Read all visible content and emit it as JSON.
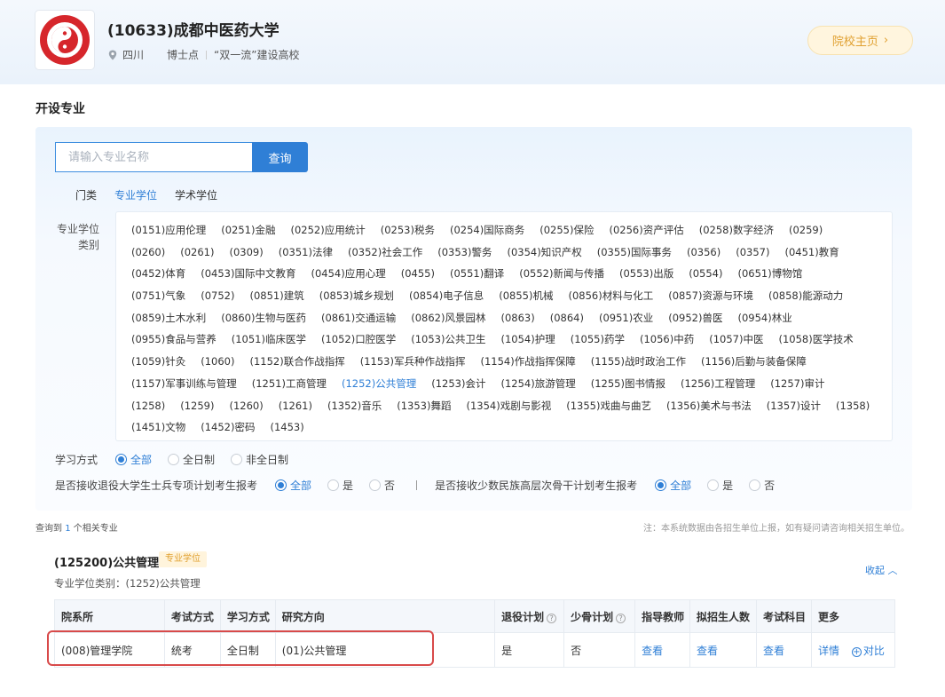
{
  "university": {
    "name": "(10633)成都中医药大学",
    "province": "四川",
    "tag_doctoral": "博士点",
    "tag_double_first": "“双一流”建设高校",
    "home_button": "院校主页",
    "colors": {
      "logo_red": "#d6262b",
      "accent": "#e0a030"
    }
  },
  "section_title": "开设专业",
  "search": {
    "placeholder": "请输入专业名称",
    "button": "查询"
  },
  "tabs": [
    {
      "label": "门类",
      "active": false
    },
    {
      "label": "专业学位",
      "active": true
    },
    {
      "label": "学术学位",
      "active": false
    }
  ],
  "category_label": "专业学位类别",
  "categories": [
    "(0151)应用伦理",
    "(0251)金融",
    "(0252)应用统计",
    "(0253)税务",
    "(0254)国际商务",
    "(0255)保险",
    "(0256)资产评估",
    "(0258)数字经济",
    "(0259)",
    "(0260)",
    "(0261)",
    "(0309)",
    "(0351)法律",
    "(0352)社会工作",
    "(0353)警务",
    "(0354)知识产权",
    "(0355)国际事务",
    "(0356)",
    "(0357)",
    "(0451)教育",
    "(0452)体育",
    "(0453)国际中文教育",
    "(0454)应用心理",
    "(0455)",
    "(0551)翻译",
    "(0552)新闻与传播",
    "(0553)出版",
    "(0554)",
    "(0651)博物馆",
    "(0751)气象",
    "(0752)",
    "(0851)建筑",
    "(0853)城乡规划",
    "(0854)电子信息",
    "(0855)机械",
    "(0856)材料与化工",
    "(0857)资源与环境",
    "(0858)能源动力",
    "(0859)土木水利",
    "(0860)生物与医药",
    "(0861)交通运输",
    "(0862)风景园林",
    "(0863)",
    "(0864)",
    "(0951)农业",
    "(0952)兽医",
    "(0954)林业",
    "(0955)食品与营养",
    "(1051)临床医学",
    "(1052)口腔医学",
    "(1053)公共卫生",
    "(1054)护理",
    "(1055)药学",
    "(1056)中药",
    "(1057)中医",
    "(1058)医学技术",
    "(1059)针灸",
    "(1060)",
    "(1152)联合作战指挥",
    "(1153)军兵种作战指挥",
    "(1154)作战指挥保障",
    "(1155)战时政治工作",
    "(1156)后勤与装备保障",
    "(1157)军事训练与管理",
    "(1251)工商管理",
    "(1252)公共管理",
    "(1253)会计",
    "(1254)旅游管理",
    "(1255)图书情报",
    "(1256)工程管理",
    "(1257)审计",
    "(1258)",
    "(1259)",
    "(1260)",
    "(1261)",
    "(1352)音乐",
    "(1353)舞蹈",
    "(1354)戏剧与影视",
    "(1355)戏曲与曲艺",
    "(1356)美术与书法",
    "(1357)设计",
    "(1358)",
    "(1451)文物",
    "(1452)密码",
    "(1453)"
  ],
  "selected_category": "(1252)公共管理",
  "filters": {
    "study_mode_label": "学习方式",
    "study_mode_options": [
      "全部",
      "全日制",
      "非全日制"
    ],
    "veteran_label": "是否接收退役大学生士兵专项计划考生报考",
    "veteran_options": [
      "全部",
      "是",
      "否"
    ],
    "minority_label": "是否接收少数民族高层次骨干计划考生报考",
    "minority_options": [
      "全部",
      "是",
      "否"
    ]
  },
  "result": {
    "count_prefix": "查询到",
    "count": "1",
    "count_suffix": "个相关专业",
    "note": "注：本系统数据由各招生单位上报，如有疑问请咨询相关招生单位。"
  },
  "major": {
    "title": "(125200)公共管理",
    "badge": "专业学位",
    "category_line": "专业学位类别：(1252)公共管理",
    "collapse": "收起",
    "columns": [
      "院系所",
      "考试方式",
      "学习方式",
      "研究方向",
      "退役计划",
      "少骨计划",
      "指导教师",
      "拟招生人数",
      "考试科目",
      "更多"
    ],
    "rows": [
      {
        "dept": "(008)管理学院",
        "exam": "统考",
        "mode": "全日制",
        "direction": "(01)公共管理",
        "veteran": "是",
        "minority": "否",
        "advisor": "查看",
        "quota": "查看",
        "subjects": "查看",
        "detail": "详情",
        "compare": "对比"
      }
    ]
  }
}
